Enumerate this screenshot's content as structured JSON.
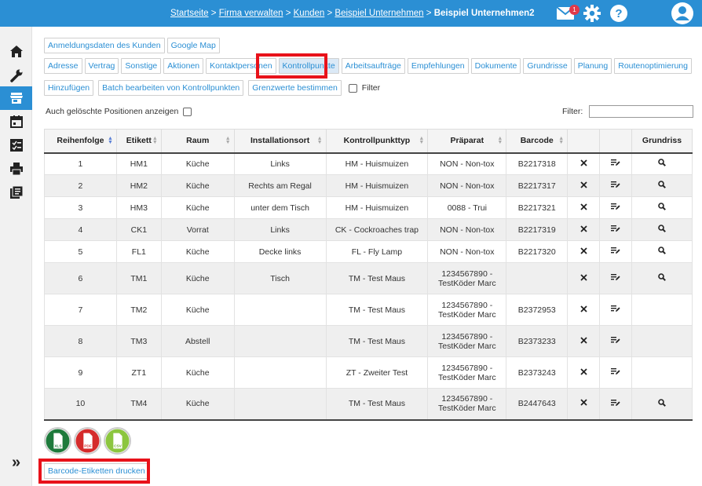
{
  "breadcrumb": {
    "items": [
      "Startseite",
      "Firma verwalten",
      "Kunden",
      "Beispiel Unternehmen"
    ],
    "separator": ">",
    "current": "Beispiel Unternehmen2"
  },
  "header": {
    "mail_badge": "1",
    "icons": [
      "mail-icon",
      "gear-icon",
      "help-icon",
      "german-flag-icon",
      "user-avatar-icon"
    ]
  },
  "sidebar": {
    "items": [
      "home-icon",
      "wrench-icon",
      "store-icon",
      "calendar-icon",
      "checklist-icon",
      "printer-icon",
      "library-icon"
    ],
    "active_index": 2,
    "expand_label": "»"
  },
  "buttons_row1": [
    "Anmeldungsdaten des Kunden",
    "Google Map"
  ],
  "tabs": [
    "Adresse",
    "Vertrag",
    "Sonstige",
    "Aktionen",
    "Kontaktpersonen",
    "Kontrollpunkte",
    "Arbeitsaufträge",
    "Empfehlungen",
    "Dokumente",
    "Grundrisse",
    "Planung",
    "Routenoptimierung"
  ],
  "active_tab": "Kontrollpunkte",
  "actions": {
    "add": "Hinzufügen",
    "batch": "Batch bearbeiten von Kontrollpunkten",
    "limits": "Grenzwerte bestimmen",
    "filter_checkbox": "Filter"
  },
  "show_deleted_label": "Auch gelöschte Positionen anzeigen",
  "filter_label": "Filter:",
  "table": {
    "columns": [
      "Reihenfolge",
      "Etikett",
      "Raum",
      "Installationsort",
      "Kontrollpunkttyp",
      "Präparat",
      "Barcode",
      "",
      "",
      "Grundriss"
    ],
    "rows": [
      {
        "order": "1",
        "label": "HM1",
        "room": "Küche",
        "location": "Links",
        "type": "HM - Huismuizen",
        "prep": "NON - Non-tox",
        "barcode": "B2217318",
        "plan": true
      },
      {
        "order": "2",
        "label": "HM2",
        "room": "Küche",
        "location": "Rechts am Regal",
        "type": "HM - Huismuizen",
        "prep": "NON - Non-tox",
        "barcode": "B2217317",
        "plan": true
      },
      {
        "order": "3",
        "label": "HM3",
        "room": "Küche",
        "location": "unter dem Tisch",
        "type": "HM - Huismuizen",
        "prep": "0088 - Trui",
        "barcode": "B2217321",
        "plan": true
      },
      {
        "order": "4",
        "label": "CK1",
        "room": "Vorrat",
        "location": "Links",
        "type": "CK - Cockroaches trap",
        "prep": "NON - Non-tox",
        "barcode": "B2217319",
        "plan": true
      },
      {
        "order": "5",
        "label": "FL1",
        "room": "Küche",
        "location": "Decke links",
        "type": "FL - Fly Lamp",
        "prep": "NON - Non-tox",
        "barcode": "B2217320",
        "plan": true
      },
      {
        "order": "6",
        "label": "TM1",
        "room": "Küche",
        "location": "Tisch",
        "type": "TM - Test Maus",
        "prep": "1234567890 - TestKöder Marc",
        "barcode": "",
        "plan": true
      },
      {
        "order": "7",
        "label": "TM2",
        "room": "Küche",
        "location": "",
        "type": "TM - Test Maus",
        "prep": "1234567890 - TestKöder Marc",
        "barcode": "B2372953",
        "plan": false
      },
      {
        "order": "8",
        "label": "TM3",
        "room": "Abstell",
        "location": "",
        "type": "TM - Test Maus",
        "prep": "1234567890 - TestKöder Marc",
        "barcode": "B2373233",
        "plan": false
      },
      {
        "order": "9",
        "label": "ZT1",
        "room": "Küche",
        "location": "",
        "type": "ZT - Zweiter Test",
        "prep": "1234567890 - TestKöder Marc",
        "barcode": "B2373243",
        "plan": false
      },
      {
        "order": "10",
        "label": "TM4",
        "room": "Küche",
        "location": "",
        "type": "TM - Test Maus",
        "prep": "1234567890 - TestKöder Marc",
        "barcode": "B2447643",
        "plan": true
      }
    ]
  },
  "exports": [
    {
      "label": "XLS",
      "color": "#1e7a3c"
    },
    {
      "label": "PDF",
      "color": "#d52b2b"
    },
    {
      "label": "CSV",
      "color": "#8cc63f"
    }
  ],
  "print_button": "Barcode-Etiketten drucken",
  "colors": {
    "accent": "#2b8fd4",
    "highlight": "#e8121a"
  }
}
